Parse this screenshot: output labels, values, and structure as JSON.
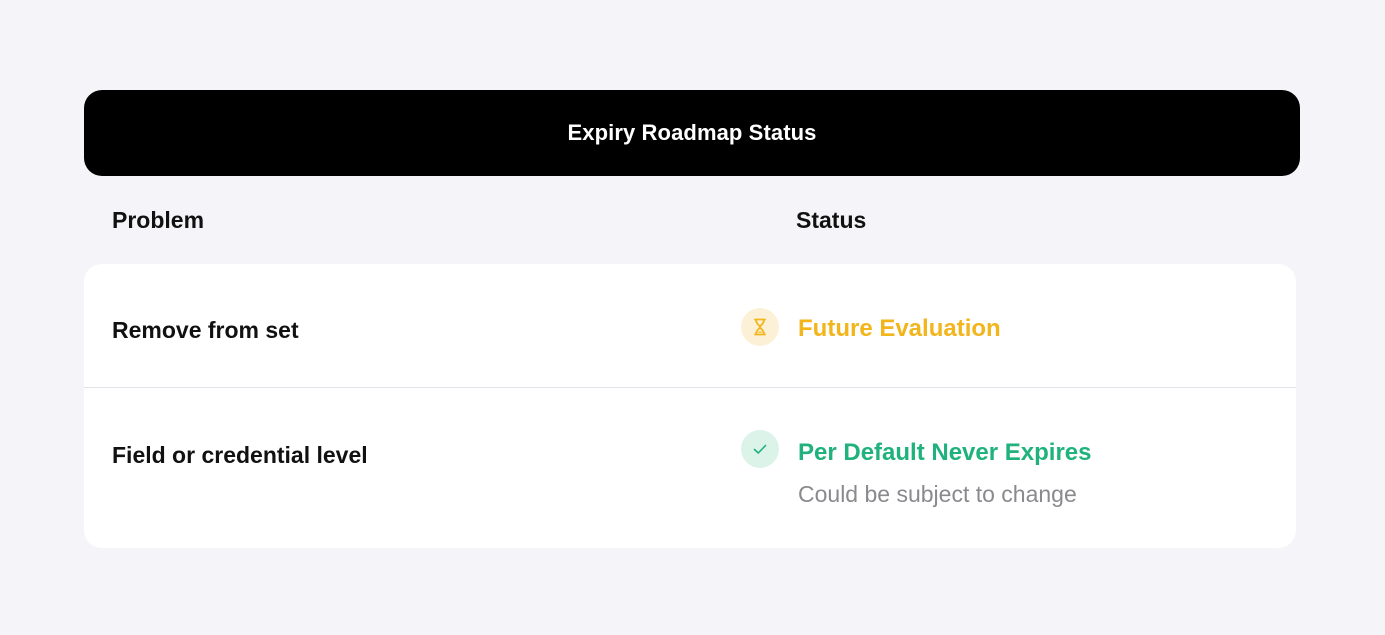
{
  "header": {
    "title": "Expiry Roadmap Status"
  },
  "table": {
    "columns": {
      "problem": "Problem",
      "status": "Status"
    },
    "rows": [
      {
        "problem": "Remove from set",
        "status": "Future Evaluation",
        "status_icon": "hourglass-icon",
        "status_color": "#f2b51b",
        "note": ""
      },
      {
        "problem": "Field or credential level",
        "status": "Per Default Never Expires",
        "status_icon": "check-icon",
        "status_color": "#1fb27c",
        "note": "Could be subject to change"
      }
    ]
  },
  "colors": {
    "page_background": "#f5f5f9",
    "header_background": "#000000",
    "card_background": "#ffffff",
    "pending_accent": "#f2b51b",
    "success_accent": "#1fb27c",
    "muted_text": "#8a8a8e"
  }
}
